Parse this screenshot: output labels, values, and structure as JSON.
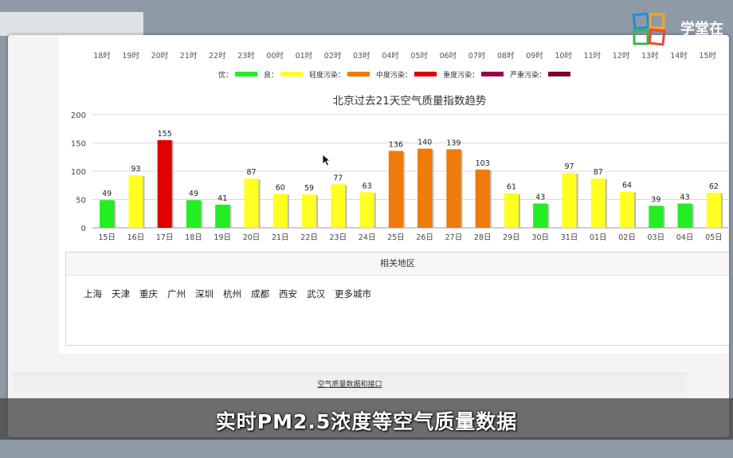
{
  "hours": [
    "18时",
    "19时",
    "20时",
    "21时",
    "22时",
    "23时",
    "00时",
    "01时",
    "02时",
    "03时",
    "04时",
    "05时",
    "06时",
    "07时",
    "08时",
    "09时",
    "10时",
    "11时",
    "12时",
    "13时",
    "14时",
    "15时"
  ],
  "legend": [
    {
      "label": "优：",
      "color": "#22ee22"
    },
    {
      "label": "良：",
      "color": "#ffff22"
    },
    {
      "label": "轻度污染：",
      "color": "#f07a0a"
    },
    {
      "label": "中度污染：",
      "color": "#e00000"
    },
    {
      "label": "重度污染：",
      "color": "#99004c"
    },
    {
      "label": "严重污染：",
      "color": "#7e0023"
    }
  ],
  "chart_data": {
    "type": "bar",
    "title": "北京过去21天空气质量指数趋势",
    "categories": [
      "15日",
      "16日",
      "17日",
      "18日",
      "19日",
      "20日",
      "21日",
      "22日",
      "23日",
      "24日",
      "25日",
      "26日",
      "27日",
      "28日",
      "29日",
      "30日",
      "31日",
      "01日",
      "02日",
      "03日",
      "04日",
      "05日"
    ],
    "values": [
      49,
      93,
      155,
      49,
      41,
      87,
      60,
      59,
      77,
      63,
      136,
      140,
      139,
      103,
      61,
      43,
      97,
      87,
      64,
      39,
      43,
      62
    ],
    "colors": [
      "#22ee22",
      "#ffff22",
      "#e00000",
      "#22ee22",
      "#22ee22",
      "#ffff22",
      "#ffff22",
      "#ffff22",
      "#ffff22",
      "#ffff22",
      "#f07a0a",
      "#f07a0a",
      "#f07a0a",
      "#f07a0a",
      "#ffff22",
      "#22ee22",
      "#ffff22",
      "#ffff22",
      "#ffff22",
      "#22ee22",
      "#22ee22",
      "#ffff22"
    ],
    "ylim": [
      0,
      200
    ],
    "yticks": [
      0,
      50,
      100,
      150,
      200
    ],
    "grid": true
  },
  "region": {
    "title": "相关地区",
    "cities": [
      "上海",
      "天津",
      "重庆",
      "广州",
      "深圳",
      "杭州",
      "成都",
      "西安",
      "武汉",
      "更多城市"
    ]
  },
  "footer": {
    "link": "空气质量数据和接口"
  },
  "caption": "实时PM2.5浓度等空气质量数据",
  "logo": {
    "text": "学堂在"
  }
}
